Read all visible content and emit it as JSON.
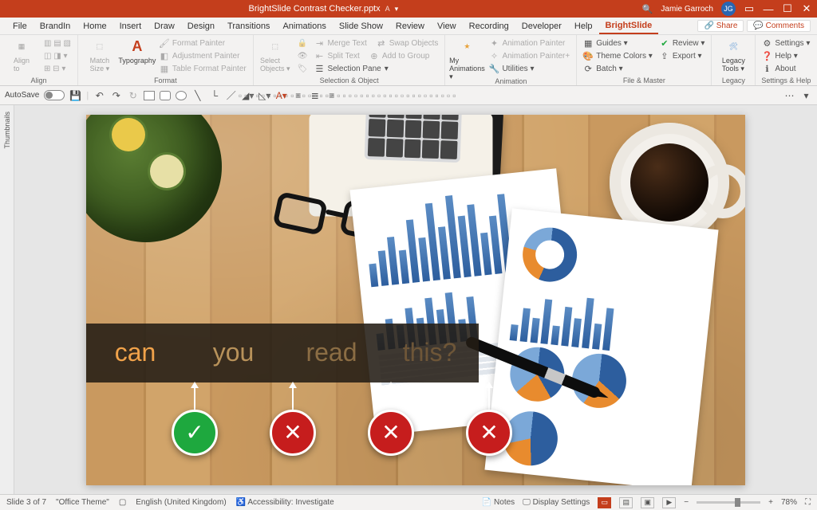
{
  "titlebar": {
    "filename": "BrightSlide Contrast Checker.pptx",
    "autosave_user_indicator": "A",
    "user_name": "Jamie Garroch",
    "user_initials": "JG"
  },
  "tabs": {
    "items": [
      "File",
      "BrandIn",
      "Home",
      "Insert",
      "Draw",
      "Design",
      "Transitions",
      "Animations",
      "Slide Show",
      "Review",
      "View",
      "Recording",
      "Developer",
      "Help",
      "BrightSlide"
    ],
    "active": "BrightSlide",
    "share": "Share",
    "comments": "Comments"
  },
  "ribbon": {
    "align": {
      "label": "Align",
      "btn": "Align\nto"
    },
    "format": {
      "label": "Format",
      "match_size": "Match\nSize ▾",
      "typography": "Typography",
      "format_painter": "Format Painter",
      "adjustment_painter": "Adjustment Painter",
      "table_format_painter": "Table Format Painter"
    },
    "selobj": {
      "label": "Selection & Object",
      "select_objects": "Select\nObjects ▾",
      "merge_text": "Merge Text",
      "swap_objects": "Swap Objects",
      "split_text": "Split Text",
      "add_to_group": "Add to Group",
      "selection_pane": "Selection Pane"
    },
    "anim": {
      "label": "Animation",
      "my_animations": "My\nAnimations ▾",
      "animation_painter": "Animation Painter",
      "animation_painter_plus": "Animation Painter+",
      "utilities": "Utilities ▾"
    },
    "filemst": {
      "label": "File & Master",
      "guides": "Guides ▾",
      "theme_colors": "Theme Colors ▾",
      "batch": "Batch ▾",
      "review": "Review ▾",
      "export": "Export ▾"
    },
    "legacy": {
      "label": "Legacy",
      "legacy_tools": "Legacy\nTools ▾"
    },
    "settings": {
      "label": "Settings & Help",
      "settings": "Settings ▾",
      "help": "Help ▾",
      "about": "About"
    }
  },
  "qat": {
    "autosave_label": "AutoSave",
    "autosave_off": "Off"
  },
  "thumbnails_label": "Thumbnails",
  "slide": {
    "words": {
      "can": "can",
      "you": "you",
      "read": "read",
      "this": "this?"
    },
    "badges": {
      "ok": "✓",
      "x": "✕"
    }
  },
  "status": {
    "slide_counter": "Slide 3 of 7",
    "theme": "\"Office Theme\"",
    "language": "English (United Kingdom)",
    "accessibility": "Accessibility: Investigate",
    "notes": "Notes",
    "display_settings": "Display Settings",
    "zoom": "78%"
  }
}
